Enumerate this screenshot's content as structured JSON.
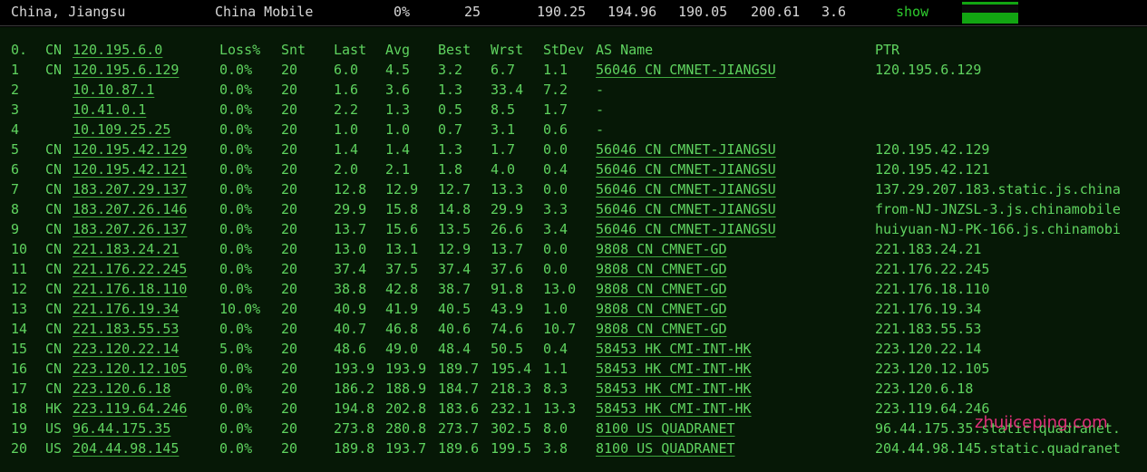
{
  "summary": {
    "location": "China, Jiangsu",
    "isp": "China Mobile",
    "loss": "0%",
    "sent": "25",
    "last": "190.25",
    "avg": "194.96",
    "best": "190.05",
    "worst": "200.61",
    "stdev": "3.6",
    "toggle_label": "show",
    "bar_fill_fraction": 1.0,
    "bar_color": "#12a512"
  },
  "trace": {
    "header": {
      "hop": "0.",
      "cc": "CN",
      "ip": "120.195.6.0",
      "loss": "Loss%",
      "snt": "Snt",
      "last": "Last",
      "avg": "Avg",
      "best": "Best",
      "wrst": "Wrst",
      "stdev": "StDev",
      "as": "AS Name",
      "ptr": "PTR"
    },
    "rows": [
      {
        "hop": "1",
        "cc": "CN",
        "ip": "120.195.6.129",
        "loss": "0.0%",
        "snt": "20",
        "last": "6.0",
        "avg": "4.5",
        "best": "3.2",
        "wrst": "6.7",
        "stdev": "1.1",
        "as": "56046 CN CMNET-JIANGSU",
        "ptr": "120.195.6.129"
      },
      {
        "hop": "2",
        "cc": "",
        "ip": "10.10.87.1",
        "loss": "0.0%",
        "snt": "20",
        "last": "1.6",
        "avg": "3.6",
        "best": "1.3",
        "wrst": "33.4",
        "stdev": "7.2",
        "as": "-",
        "ptr": ""
      },
      {
        "hop": "3",
        "cc": "",
        "ip": "10.41.0.1",
        "loss": "0.0%",
        "snt": "20",
        "last": "2.2",
        "avg": "1.3",
        "best": "0.5",
        "wrst": "8.5",
        "stdev": "1.7",
        "as": "-",
        "ptr": ""
      },
      {
        "hop": "4",
        "cc": "",
        "ip": "10.109.25.25",
        "loss": "0.0%",
        "snt": "20",
        "last": "1.0",
        "avg": "1.0",
        "best": "0.7",
        "wrst": "3.1",
        "stdev": "0.6",
        "as": "-",
        "ptr": ""
      },
      {
        "hop": "5",
        "cc": "CN",
        "ip": "120.195.42.129",
        "loss": "0.0%",
        "snt": "20",
        "last": "1.4",
        "avg": "1.4",
        "best": "1.3",
        "wrst": "1.7",
        "stdev": "0.0",
        "as": "56046 CN CMNET-JIANGSU",
        "ptr": "120.195.42.129"
      },
      {
        "hop": "6",
        "cc": "CN",
        "ip": "120.195.42.121",
        "loss": "0.0%",
        "snt": "20",
        "last": "2.0",
        "avg": "2.1",
        "best": "1.8",
        "wrst": "4.0",
        "stdev": "0.4",
        "as": "56046 CN CMNET-JIANGSU",
        "ptr": "120.195.42.121"
      },
      {
        "hop": "7",
        "cc": "CN",
        "ip": "183.207.29.137",
        "loss": "0.0%",
        "snt": "20",
        "last": "12.8",
        "avg": "12.9",
        "best": "12.7",
        "wrst": "13.3",
        "stdev": "0.0",
        "as": "56046 CN CMNET-JIANGSU",
        "ptr": "137.29.207.183.static.js.china"
      },
      {
        "hop": "8",
        "cc": "CN",
        "ip": "183.207.26.146",
        "loss": "0.0%",
        "snt": "20",
        "last": "29.9",
        "avg": "15.8",
        "best": "14.8",
        "wrst": "29.9",
        "stdev": "3.3",
        "as": "56046 CN CMNET-JIANGSU",
        "ptr": "from-NJ-JNZSL-3.js.chinamobile"
      },
      {
        "hop": "9",
        "cc": "CN",
        "ip": "183.207.26.137",
        "loss": "0.0%",
        "snt": "20",
        "last": "13.7",
        "avg": "15.6",
        "best": "13.5",
        "wrst": "26.6",
        "stdev": "3.4",
        "as": "56046 CN CMNET-JIANGSU",
        "ptr": "huiyuan-NJ-PK-166.js.chinamobi"
      },
      {
        "hop": "10",
        "cc": "CN",
        "ip": "221.183.24.21",
        "loss": "0.0%",
        "snt": "20",
        "last": "13.0",
        "avg": "13.1",
        "best": "12.9",
        "wrst": "13.7",
        "stdev": "0.0",
        "as": "9808  CN CMNET-GD",
        "ptr": "221.183.24.21"
      },
      {
        "hop": "11",
        "cc": "CN",
        "ip": "221.176.22.245",
        "loss": "0.0%",
        "snt": "20",
        "last": "37.4",
        "avg": "37.5",
        "best": "37.4",
        "wrst": "37.6",
        "stdev": "0.0",
        "as": "9808  CN CMNET-GD",
        "ptr": "221.176.22.245"
      },
      {
        "hop": "12",
        "cc": "CN",
        "ip": "221.176.18.110",
        "loss": "0.0%",
        "snt": "20",
        "last": "38.8",
        "avg": "42.8",
        "best": "38.7",
        "wrst": "91.8",
        "stdev": "13.0",
        "as": "9808  CN CMNET-GD",
        "ptr": "221.176.18.110"
      },
      {
        "hop": "13",
        "cc": "CN",
        "ip": "221.176.19.34",
        "loss": "10.0%",
        "snt": "20",
        "last": "40.9",
        "avg": "41.9",
        "best": "40.5",
        "wrst": "43.9",
        "stdev": "1.0",
        "as": "9808  CN CMNET-GD",
        "ptr": "221.176.19.34"
      },
      {
        "hop": "14",
        "cc": "CN",
        "ip": "221.183.55.53",
        "loss": "0.0%",
        "snt": "20",
        "last": "40.7",
        "avg": "46.8",
        "best": "40.6",
        "wrst": "74.6",
        "stdev": "10.7",
        "as": "9808  CN CMNET-GD",
        "ptr": "221.183.55.53"
      },
      {
        "hop": "15",
        "cc": "CN",
        "ip": "223.120.22.14",
        "loss": "5.0%",
        "snt": "20",
        "last": "48.6",
        "avg": "49.0",
        "best": "48.4",
        "wrst": "50.5",
        "stdev": "0.4",
        "as": "58453 HK CMI-INT-HK",
        "ptr": "223.120.22.14"
      },
      {
        "hop": "16",
        "cc": "CN",
        "ip": "223.120.12.105",
        "loss": "0.0%",
        "snt": "20",
        "last": "193.9",
        "avg": "193.9",
        "best": "189.7",
        "wrst": "195.4",
        "stdev": "1.1",
        "as": "58453 HK CMI-INT-HK",
        "ptr": "223.120.12.105"
      },
      {
        "hop": "17",
        "cc": "CN",
        "ip": "223.120.6.18",
        "loss": "0.0%",
        "snt": "20",
        "last": "186.2",
        "avg": "188.9",
        "best": "184.7",
        "wrst": "218.3",
        "stdev": "8.3",
        "as": "58453 HK CMI-INT-HK",
        "ptr": "223.120.6.18"
      },
      {
        "hop": "18",
        "cc": "HK",
        "ip": "223.119.64.246",
        "loss": "0.0%",
        "snt": "20",
        "last": "194.8",
        "avg": "202.8",
        "best": "183.6",
        "wrst": "232.1",
        "stdev": "13.3",
        "as": "58453 HK CMI-INT-HK",
        "ptr": "223.119.64.246"
      },
      {
        "hop": "19",
        "cc": "US",
        "ip": "96.44.175.35",
        "loss": "0.0%",
        "snt": "20",
        "last": "273.8",
        "avg": "280.8",
        "best": "273.7",
        "wrst": "302.5",
        "stdev": "8.0",
        "as": "8100  US QUADRANET",
        "ptr": "96.44.175.35.static.quadranet."
      },
      {
        "hop": "20",
        "cc": "US",
        "ip": "204.44.98.145",
        "loss": "0.0%",
        "snt": "20",
        "last": "189.8",
        "avg": "193.7",
        "best": "189.6",
        "wrst": "199.5",
        "stdev": "3.8",
        "as": "8100  US QUADRANET",
        "ptr": "204.44.98.145.static.quadranet"
      }
    ]
  },
  "watermark": "zhujiceping.com"
}
